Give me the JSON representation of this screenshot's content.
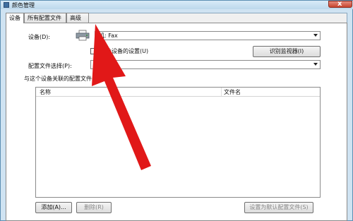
{
  "window": {
    "title": "颜色管理",
    "close_label": "x"
  },
  "tabs": [
    {
      "label": "设备"
    },
    {
      "label": "所有配置文件"
    },
    {
      "label": "高级"
    }
  ],
  "settings": {
    "device_label": "设备(D):",
    "device_value": "机: Fax",
    "use_settings_label": "对此设备的设置(U)",
    "identify_button": "识别监视器(I)",
    "profile_selection_label": "配置文件选择(P):",
    "profile_selection_value": "自",
    "associated_profiles_label": "与这个设备关联的配置文件(",
    "list_columns": [
      "名称",
      "文件名"
    ],
    "add_button": "添加(A)...",
    "remove_button": "删除(R)",
    "set_default_button": "设置为默认配置文件(S)"
  },
  "colors": {
    "arrow": "#e11818",
    "accent": "#3f88b3"
  }
}
